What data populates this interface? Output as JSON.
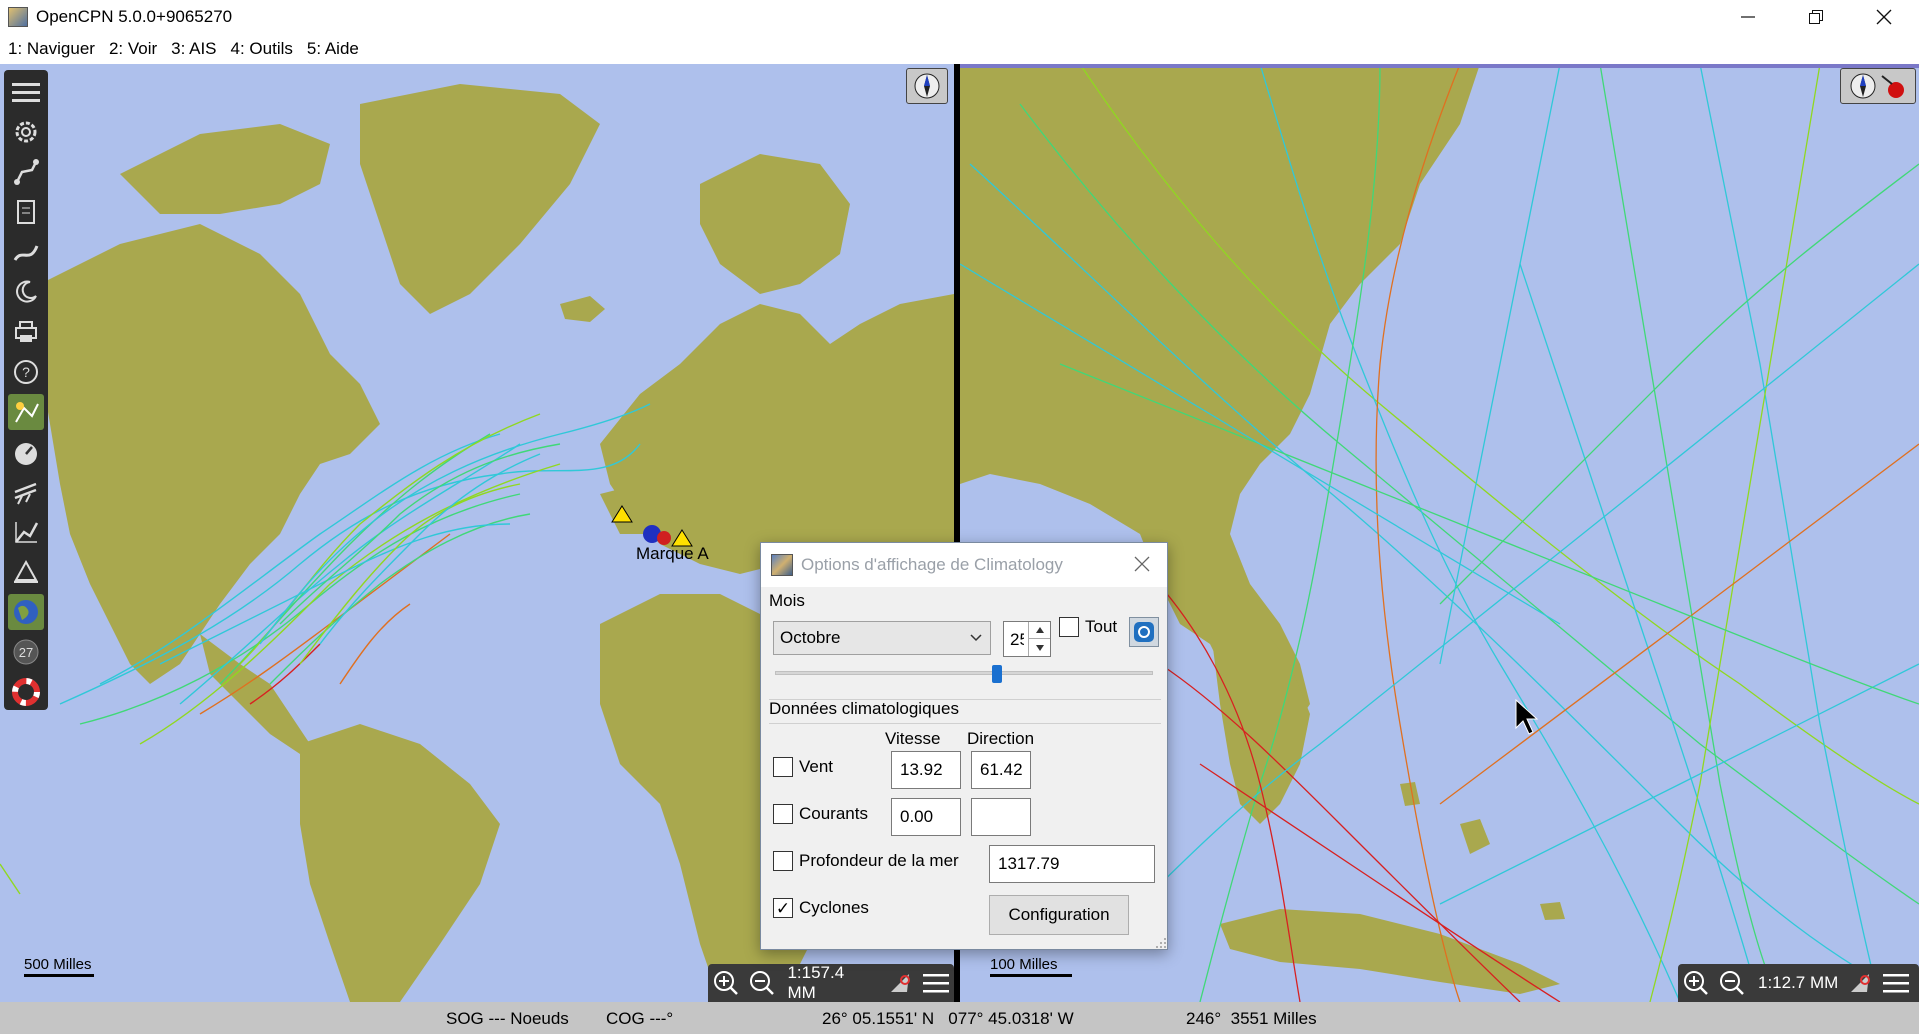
{
  "window": {
    "title": "OpenCPN 5.0.0+9065270",
    "minimize_icon": "minimize-icon",
    "restore_icon": "restore-icon",
    "close_icon": "close-icon"
  },
  "menu": [
    {
      "label": "1: Naviguer"
    },
    {
      "label": "2: Voir"
    },
    {
      "label": "3: AIS"
    },
    {
      "label": "4: Outils"
    },
    {
      "label": "5: Aide"
    }
  ],
  "toolbar": {
    "icons": [
      "menu-icon",
      "gear-icon",
      "route-icon",
      "document-icon",
      "track-icon",
      "moon-icon",
      "print-icon",
      "help-icon",
      "weather-icon",
      "dashboard-icon",
      "grib-icon",
      "plot-icon",
      "plane-icon",
      "globe-icon",
      "tide-icon",
      "lifebuoy-icon"
    ]
  },
  "left_map": {
    "mark_label": "Marque A",
    "scale_label": "500 Milles",
    "zoom_level": "1:157.4 MM"
  },
  "right_map": {
    "scale_label": "100 Milles",
    "zoom_level": "1:12.7 MM"
  },
  "dialog": {
    "title": "Options d'affichage de Climatology",
    "month_section": "Mois",
    "month_value": "Octobre",
    "day_value": "25",
    "all_label": "Tout",
    "all_checked": false,
    "slider_fraction": 0.59,
    "data_section": "Données climatologiques",
    "col_speed": "Vitesse",
    "col_direction": "Direction",
    "rows": {
      "wind": {
        "label": "Vent",
        "checked": false,
        "speed": "13.92",
        "direction": "61.42"
      },
      "currents": {
        "label": "Courants",
        "checked": false,
        "speed": "0.00",
        "direction": ""
      },
      "depth": {
        "label": "Profondeur de la mer",
        "checked": false,
        "value": "1317.79"
      },
      "cyclones": {
        "label": "Cyclones",
        "checked": true
      }
    },
    "config_button": "Configuration"
  },
  "status": {
    "sog": "SOG --- Noeuds",
    "cog": "COG ---°",
    "position": "26° 05.1551' N   077° 45.0318' W",
    "bearing_distance": "246°  3551 Milles"
  },
  "colors": {
    "sea": "#aec0ec",
    "land": "#a9a84e",
    "tracks": [
      "#30c8d8",
      "#40d878",
      "#90d820",
      "#e07020",
      "#d82020"
    ]
  }
}
